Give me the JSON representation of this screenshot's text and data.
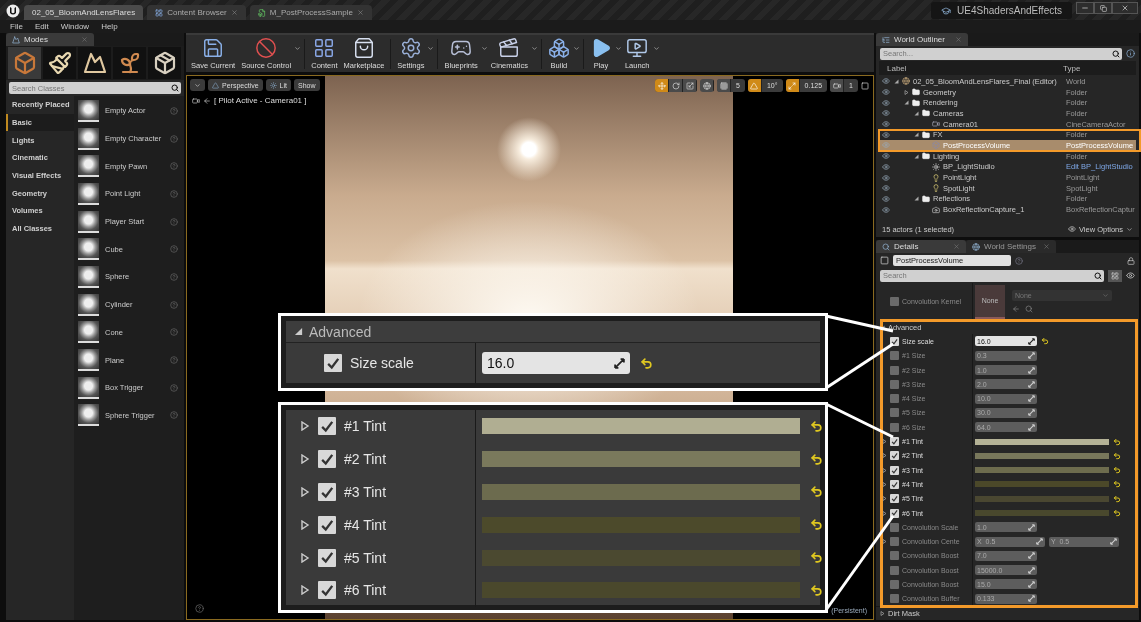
{
  "title_bar": {
    "tabs": [
      {
        "label": "02_05_BloomAndLensFlares",
        "selected": true,
        "kind": "level",
        "closable": false
      },
      {
        "label": "Content Browser",
        "selected": false,
        "kind": "browser",
        "closable": true
      },
      {
        "label": "M_PostProcessSample",
        "selected": false,
        "kind": "material",
        "closable": true
      }
    ],
    "project": "UE4ShadersAndEffects"
  },
  "menu": [
    "File",
    "Edit",
    "Window",
    "Help"
  ],
  "modes": {
    "title": "Modes",
    "tools": [
      {
        "kind": "place",
        "selected": true
      },
      {
        "kind": "paint",
        "selected": false
      },
      {
        "kind": "landscape",
        "selected": false
      },
      {
        "kind": "foliage",
        "selected": false
      },
      {
        "kind": "geometry",
        "selected": false
      }
    ],
    "search_placeholder": "Search Classes",
    "categories": [
      {
        "label": "Recently Placed",
        "selected": false
      },
      {
        "label": "Basic",
        "selected": true
      },
      {
        "label": "Lights",
        "selected": false
      },
      {
        "label": "Cinematic",
        "selected": false
      },
      {
        "label": "Visual Effects",
        "selected": false
      },
      {
        "label": "Geometry",
        "selected": false
      },
      {
        "label": "Volumes",
        "selected": false
      },
      {
        "label": "All Classes",
        "selected": false
      }
    ],
    "items": [
      "Empty Actor",
      "Empty Character",
      "Empty Pawn",
      "Point Light",
      "Player Start",
      "Cube",
      "Sphere",
      "Cylinder",
      "Cone",
      "Plane",
      "Box Trigger",
      "Sphere Trigger"
    ]
  },
  "toolbar": [
    {
      "label": "Save Current",
      "kind": "save",
      "dropdown": false
    },
    {
      "label": "Source Control",
      "kind": "source_control",
      "dropdown": true
    },
    {
      "label": "Content",
      "kind": "content",
      "dropdown": false
    },
    {
      "label": "Marketplace",
      "kind": "marketplace",
      "dropdown": false
    },
    {
      "label": "Settings",
      "kind": "settings",
      "dropdown": true
    },
    {
      "label": "Blueprints",
      "kind": "blueprints",
      "dropdown": true
    },
    {
      "label": "Cinematics",
      "kind": "cinematics",
      "dropdown": true
    },
    {
      "label": "Build",
      "kind": "build",
      "dropdown": true
    },
    {
      "label": "Play",
      "kind": "play",
      "dropdown": true
    },
    {
      "label": "Launch",
      "kind": "launch",
      "dropdown": true
    }
  ],
  "viewport": {
    "view_buttons": [
      "Perspective",
      "Lit",
      "Show"
    ],
    "pilot_label": "[ Pilot Active - Camera01 ]",
    "grid_snap": "5",
    "rotation_snap": "10°",
    "scale_snap": "0.125",
    "camera_speed": "1",
    "level_label": "(Persistent)"
  },
  "outliner": {
    "title": "World Outliner",
    "search_placeholder": "Search...",
    "columns": [
      "Label",
      "Type"
    ],
    "tree": [
      {
        "label": "02_05_BloomAndLensFlares_Final (Editor)",
        "type": "World",
        "kind": "world",
        "selected": false,
        "type_link": false,
        "expanded": true,
        "children": [
          {
            "label": "Geometry",
            "type": "Folder",
            "kind": "folder",
            "selected": false,
            "type_link": false,
            "expanded": false
          },
          {
            "label": "Rendering",
            "type": "Folder",
            "kind": "folder",
            "selected": false,
            "type_link": false,
            "expanded": true,
            "children": [
              {
                "label": "Cameras",
                "type": "Folder",
                "kind": "folder",
                "selected": false,
                "type_link": false,
                "expanded": true,
                "children": [
                  {
                    "label": "Camera01",
                    "type": "CineCameraActor",
                    "kind": "camera",
                    "selected": false,
                    "type_link": false
                  }
                ]
              },
              {
                "label": "FX",
                "type": "Folder",
                "kind": "folder",
                "selected": false,
                "type_link": false,
                "expanded": true,
                "children": [
                  {
                    "label": "PostProcessVolume",
                    "type": "PostProcessVolume",
                    "kind": "volume",
                    "selected": true,
                    "type_link": false
                  }
                ]
              },
              {
                "label": "Lighting",
                "type": "Folder",
                "kind": "folder",
                "selected": false,
                "type_link": false,
                "expanded": true,
                "children": [
                  {
                    "label": "BP_LightStudio",
                    "type": "Edit BP_LightStudio",
                    "kind": "blueprint",
                    "selected": false,
                    "type_link": true
                  },
                  {
                    "label": "PointLight",
                    "type": "PointLight",
                    "kind": "light",
                    "selected": false,
                    "type_link": false
                  },
                  {
                    "label": "SpotLight",
                    "type": "SpotLight",
                    "kind": "light",
                    "selected": false,
                    "type_link": false
                  }
                ]
              },
              {
                "label": "Reflections",
                "type": "Folder",
                "kind": "folder",
                "selected": false,
                "type_link": false,
                "expanded": true,
                "children": [
                  {
                    "label": "BoxReflectionCapture_1",
                    "type": "BoxReflectionCaptur",
                    "kind": "reflection",
                    "selected": false,
                    "type_link": false
                  }
                ]
              }
            ]
          }
        ]
      }
    ],
    "footer": "15 actors (1 selected)",
    "view_options": "View Options"
  },
  "details": {
    "tabs": [
      {
        "label": "Details",
        "selected": true
      },
      {
        "label": "World Settings",
        "selected": false
      }
    ],
    "actor_name": "PostProcessVolume",
    "search_placeholder": "Search",
    "kernel": {
      "label": "Convolution Kernel",
      "checked": false,
      "thumbnail": "None",
      "asset": "None"
    },
    "advanced": {
      "title": "Advanced",
      "expanded": true,
      "rows": [
        {
          "kind": "number",
          "label": "Size scale",
          "checked": true,
          "value": "16.0",
          "reset": true
        },
        {
          "kind": "number",
          "label": "#1 Size",
          "checked": false,
          "value": "0.3",
          "reset": false
        },
        {
          "kind": "number",
          "label": "#2 Size",
          "checked": false,
          "value": "1.0",
          "reset": false
        },
        {
          "kind": "number",
          "label": "#3 Size",
          "checked": false,
          "value": "2.0",
          "reset": false
        },
        {
          "kind": "number",
          "label": "#4 Size",
          "checked": false,
          "value": "10.0",
          "reset": false
        },
        {
          "kind": "number",
          "label": "#5 Size",
          "checked": false,
          "value": "30.0",
          "reset": false
        },
        {
          "kind": "number",
          "label": "#6 Size",
          "checked": false,
          "value": "64.0",
          "reset": false
        },
        {
          "kind": "color",
          "label": "#1 Tint",
          "checked": true,
          "color": "#b4b296",
          "reset": true,
          "expanded": false
        },
        {
          "kind": "color",
          "label": "#2 Tint",
          "checked": true,
          "color": "#78775b",
          "reset": true,
          "expanded": false
        },
        {
          "kind": "color",
          "label": "#3 Tint",
          "checked": true,
          "color": "#6d6c4e",
          "reset": true,
          "expanded": false
        },
        {
          "kind": "color",
          "label": "#4 Tint",
          "checked": true,
          "color": "#4b4829",
          "reset": true,
          "expanded": false
        },
        {
          "kind": "color",
          "label": "#5 Tint",
          "checked": true,
          "color": "#4a4731",
          "reset": true,
          "expanded": false
        },
        {
          "kind": "color",
          "label": "#6 Tint",
          "checked": true,
          "color": "#49482d",
          "reset": true,
          "expanded": false
        },
        {
          "kind": "number",
          "label": "Convolution Scale",
          "checked": false,
          "value": "1.0",
          "reset": false
        },
        {
          "kind": "vector",
          "label": "Convolution Cente",
          "checked": false,
          "x": "X  0.5",
          "y": "Y  0.5",
          "reset": false,
          "expanded": false
        },
        {
          "kind": "number",
          "label": "Convolution Boost",
          "checked": false,
          "value": "7.0",
          "reset": false
        },
        {
          "kind": "number",
          "label": "Convolution Boost",
          "checked": false,
          "value": "15000.0",
          "reset": false
        },
        {
          "kind": "number",
          "label": "Convolution Boost",
          "checked": false,
          "value": "15.0",
          "reset": false
        },
        {
          "kind": "number",
          "label": "Convolution Buffer",
          "checked": false,
          "value": "0.133",
          "reset": false
        }
      ]
    },
    "dirt_mask": {
      "title": "Dirt Mask",
      "expanded": false
    }
  },
  "callouts": [
    {
      "kind": "section",
      "title": "Advanced",
      "expanded": true,
      "rows": [
        {
          "label": "Size scale",
          "checked": true,
          "value": "16.0",
          "reset": true
        }
      ]
    },
    {
      "kind": "tints",
      "rows": [
        {
          "label": "#1 Tint",
          "checked": true,
          "color": "#b0ae92",
          "reset": true,
          "expanded": false
        },
        {
          "label": "#2 Tint",
          "checked": true,
          "color": "#7a795c",
          "reset": true,
          "expanded": false
        },
        {
          "label": "#3 Tint",
          "checked": true,
          "color": "#6c6b4e",
          "reset": true,
          "expanded": false
        },
        {
          "label": "#4 Tint",
          "checked": true,
          "color": "#4c4a2b",
          "reset": true,
          "expanded": false
        },
        {
          "label": "#5 Tint",
          "checked": true,
          "color": "#4b4930",
          "reset": true,
          "expanded": false
        },
        {
          "label": "#6 Tint",
          "checked": true,
          "color": "#4a482c",
          "reset": true,
          "expanded": false
        }
      ]
    }
  ]
}
